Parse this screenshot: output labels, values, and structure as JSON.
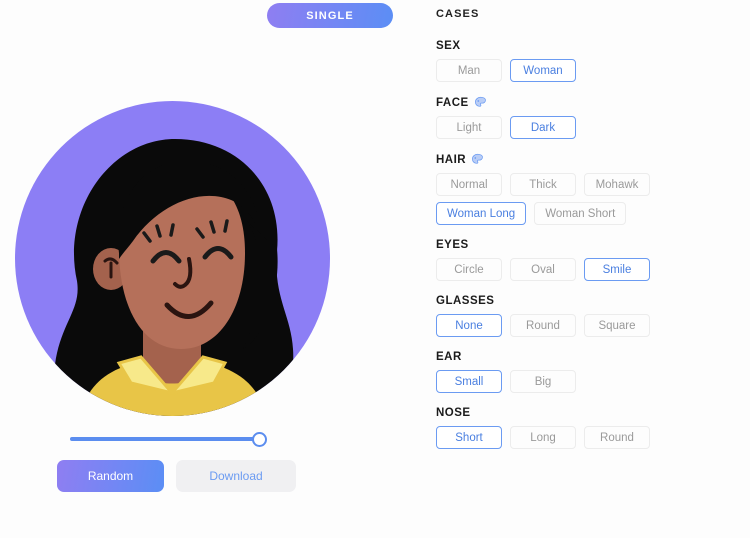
{
  "tabs": [
    {
      "label": "SINGLE",
      "active": true
    }
  ],
  "avatar": {
    "colors": {
      "background_circle": "#8c7ef5",
      "hair": "#0a0a0a",
      "skin": "#b5705a",
      "shirt": "#e8c547",
      "collar": "#f7e98a",
      "stroke": "#0a0a0a"
    }
  },
  "slider": {
    "name": "size-slider",
    "value": 100,
    "min": 0,
    "max": 100,
    "track_color": "#5b8def"
  },
  "actions": {
    "random_label": "Random",
    "download_label": "Download"
  },
  "panel": {
    "title": "CASES",
    "palette_icon": "palette-icon",
    "sections": [
      {
        "id": "sex",
        "label": "SEX",
        "has_color_picker": false,
        "rows": [
          [
            {
              "label": "Man",
              "active": false
            },
            {
              "label": "Woman",
              "active": true
            }
          ]
        ]
      },
      {
        "id": "face",
        "label": "FACE",
        "has_color_picker": true,
        "rows": [
          [
            {
              "label": "Light",
              "active": false
            },
            {
              "label": "Dark",
              "active": true
            }
          ]
        ]
      },
      {
        "id": "hair",
        "label": "HAIR",
        "has_color_picker": true,
        "rows": [
          [
            {
              "label": "Normal",
              "active": false
            },
            {
              "label": "Thick",
              "active": false
            },
            {
              "label": "Mohawk",
              "active": false
            }
          ],
          [
            {
              "label": "Woman Long",
              "active": true
            },
            {
              "label": "Woman Short",
              "active": false
            }
          ]
        ]
      },
      {
        "id": "eyes",
        "label": "EYES",
        "has_color_picker": false,
        "rows": [
          [
            {
              "label": "Circle",
              "active": false
            },
            {
              "label": "Oval",
              "active": false
            },
            {
              "label": "Smile",
              "active": true
            }
          ]
        ]
      },
      {
        "id": "glasses",
        "label": "GLASSES",
        "has_color_picker": false,
        "rows": [
          [
            {
              "label": "None",
              "active": true
            },
            {
              "label": "Round",
              "active": false
            },
            {
              "label": "Square",
              "active": false
            }
          ]
        ]
      },
      {
        "id": "ear",
        "label": "EAR",
        "has_color_picker": false,
        "rows": [
          [
            {
              "label": "Small",
              "active": true
            },
            {
              "label": "Big",
              "active": false
            }
          ]
        ]
      },
      {
        "id": "nose",
        "label": "NOSE",
        "has_color_picker": false,
        "rows": [
          [
            {
              "label": "Short",
              "active": true
            },
            {
              "label": "Long",
              "active": false
            },
            {
              "label": "Round",
              "active": false
            }
          ]
        ]
      }
    ]
  }
}
